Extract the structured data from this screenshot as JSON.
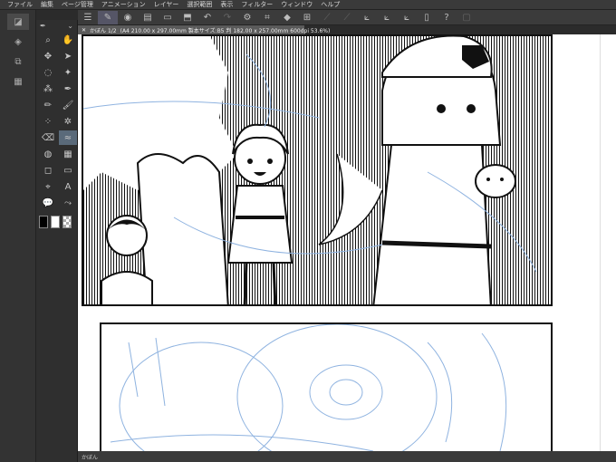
{
  "menu": [
    "ファイル",
    "編集",
    "ページ管理",
    "アニメーション",
    "レイヤー",
    "選択範囲",
    "表示",
    "フィルター",
    "ウィンドウ",
    "ヘルプ"
  ],
  "toolbar": {
    "icons": [
      "menu-icon",
      "pen-icon",
      "record-icon",
      "clipboard-icon",
      "folder-icon",
      "save-icon",
      "undo-icon",
      "redo-icon",
      "gear-icon",
      "crop-icon",
      "fill-icon",
      "transform-icon",
      "ruler-icon",
      "ruler2-icon",
      "brush1-icon",
      "brush2-icon",
      "brush3-icon",
      "page-icon",
      "help-icon",
      "frame-icon"
    ]
  },
  "tool_palette": {
    "tools": [
      "zoom-icon",
      "hand-icon",
      "move-icon",
      "arrow-icon",
      "lasso-icon",
      "magic-wand-icon",
      "eyedropper-icon",
      "pen-tool-icon",
      "pencil-icon",
      "brush-icon",
      "airbrush-icon",
      "decoration-icon",
      "eraser-icon",
      "blend-icon",
      "fill-tool-icon",
      "gradient-icon",
      "figure-icon",
      "frame-border-icon",
      "ruler-tool-icon",
      "text-icon",
      "balloon-icon",
      "correction-icon"
    ]
  },
  "document": {
    "tab_label": "かぼん 1/2",
    "tab_info": "(A4 210.00 x 297.00mm 製本サイズ:B5 判 182.00 x 257.00mm 600dpi 53.6%)"
  },
  "status": {
    "label": "かぼん"
  },
  "colors": {
    "ui_dark": "#2b2b2b",
    "canvas": "#ffffff",
    "sketch": "#8fb3e0"
  }
}
